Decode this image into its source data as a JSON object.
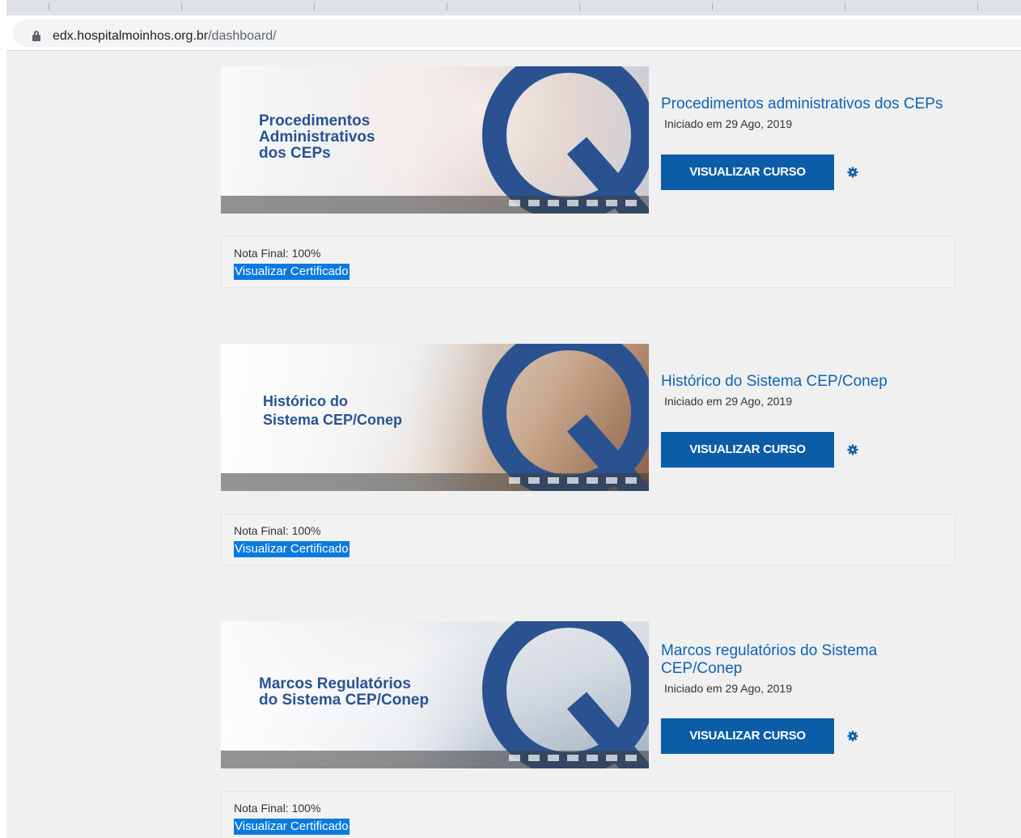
{
  "browser": {
    "url_host": "edx.hospitalmoinhos.org.br",
    "url_path": "/dashboard/"
  },
  "colors": {
    "brand_blue": "#2a5291",
    "link_blue": "#0d63b6",
    "button_blue": "#0c5da8",
    "highlight_blue": "#0a7ae0"
  },
  "courses": [
    {
      "thumb_title": "Procedimentos\nAdministrativos\ndos CEPs",
      "title": "Procedimentos administrativos dos CEPs",
      "started": "Iniciado em 29 Ago, 2019",
      "button_label": "VISUALIZAR CURSO",
      "settings_icon": "gear-icon",
      "grade_label": "Nota Final: 100%",
      "certificate_link": "Visualizar Certificado"
    },
    {
      "thumb_title": "Histórico do\nSistema CEP/Conep",
      "title": "Histórico do Sistema CEP/Conep",
      "started": "Iniciado em 29 Ago, 2019",
      "button_label": "VISUALIZAR CURSO",
      "settings_icon": "gear-icon",
      "grade_label": "Nota Final: 100%",
      "certificate_link": "Visualizar Certificado"
    },
    {
      "thumb_title": "Marcos Regulatórios\ndo Sistema CEP/Conep",
      "title": "Marcos regulatórios do Sistema CEP/Conep",
      "started": "Iniciado em 29 Ago, 2019",
      "button_label": "VISUALIZAR CURSO",
      "settings_icon": "gear-icon",
      "grade_label": "Nota Final: 100%",
      "certificate_link": "Visualizar Certificado"
    }
  ]
}
